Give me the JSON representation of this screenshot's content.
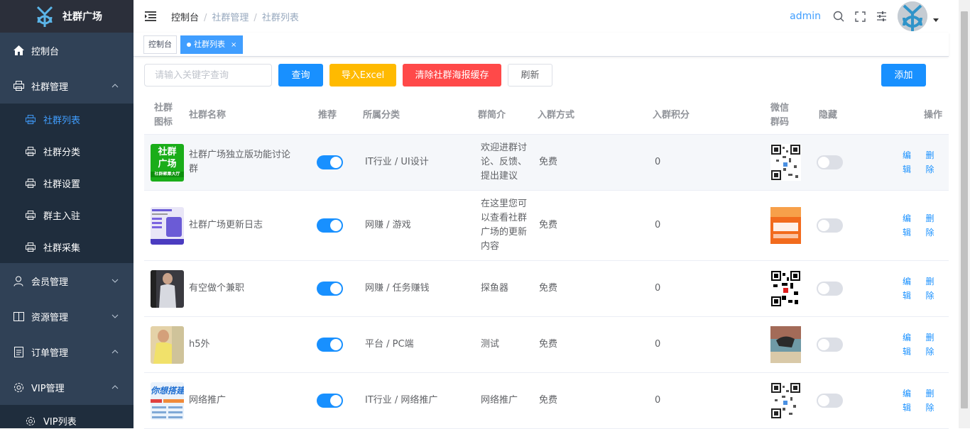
{
  "app": {
    "name": "社群广场"
  },
  "sidebar": {
    "items": [
      {
        "label": "控制台",
        "icon": "home-icon"
      },
      {
        "label": "社群管理",
        "icon": "print-icon"
      },
      {
        "label": "社群列表",
        "icon": "print-icon"
      },
      {
        "label": "社群分类",
        "icon": "print-icon"
      },
      {
        "label": "社群设置",
        "icon": "print-icon"
      },
      {
        "label": "群主入驻",
        "icon": "print-icon"
      },
      {
        "label": "社群采集",
        "icon": "print-icon"
      },
      {
        "label": "会员管理",
        "icon": "user-icon"
      },
      {
        "label": "资源管理",
        "icon": "book-icon"
      },
      {
        "label": "订单管理",
        "icon": "document-icon"
      },
      {
        "label": "VIP管理",
        "icon": "gear-icon"
      },
      {
        "label": "VIP列表",
        "icon": "gear-icon"
      }
    ]
  },
  "navbar": {
    "breadcrumb": [
      "控制台",
      "社群管理",
      "社群列表"
    ],
    "user": "admin"
  },
  "tags": [
    {
      "label": "控制台"
    },
    {
      "label": "社群列表",
      "close": "×"
    }
  ],
  "toolbar": {
    "search_placeholder": "请输入关键字查询",
    "query": "查询",
    "import": "导入Excel",
    "clear_cache": "清除社群海报缓存",
    "refresh": "刷新",
    "add": "添加"
  },
  "table": {
    "headers": {
      "icon": "社群图标",
      "name": "社群名称",
      "recommend": "推荐",
      "category": "所属分类",
      "intro": "群简介",
      "join_method": "入群方式",
      "points": "入群积分",
      "qrcode": "微信群码",
      "hidden": "隐藏",
      "actions": "操作"
    },
    "edit_label": "编辑",
    "delete_label": "删除",
    "rows": [
      {
        "name": "社群广场独立版功能讨论群",
        "thumb_text": "社群广场",
        "thumb_sub": "社群聚集大厅",
        "recommend": true,
        "category": "IT行业 / UI设计",
        "intro": "欢迎进群讨论、反馈、提出建议",
        "join": "免费",
        "points": "0",
        "hidden": false
      },
      {
        "name": "社群广场更新日志",
        "recommend": true,
        "category": "网赚 / 游戏",
        "intro": "在这里您可以查看社群广场的更新内容",
        "join": "免费",
        "points": "0",
        "hidden": false
      },
      {
        "name": "有空做个兼职",
        "recommend": true,
        "category": "网赚 / 任务赚钱",
        "intro": "探鱼器",
        "join": "免费",
        "points": "0",
        "hidden": false
      },
      {
        "name": "h5外",
        "recommend": true,
        "category": "平台 / PC端",
        "intro": "测试",
        "join": "免费",
        "points": "0",
        "hidden": false
      },
      {
        "name": "网络推广",
        "thumb_text": "你想搭建",
        "recommend": true,
        "category": "IT行业 / 网络推广",
        "intro": "网络推广",
        "join": "免费",
        "points": "0",
        "hidden": false
      }
    ]
  }
}
